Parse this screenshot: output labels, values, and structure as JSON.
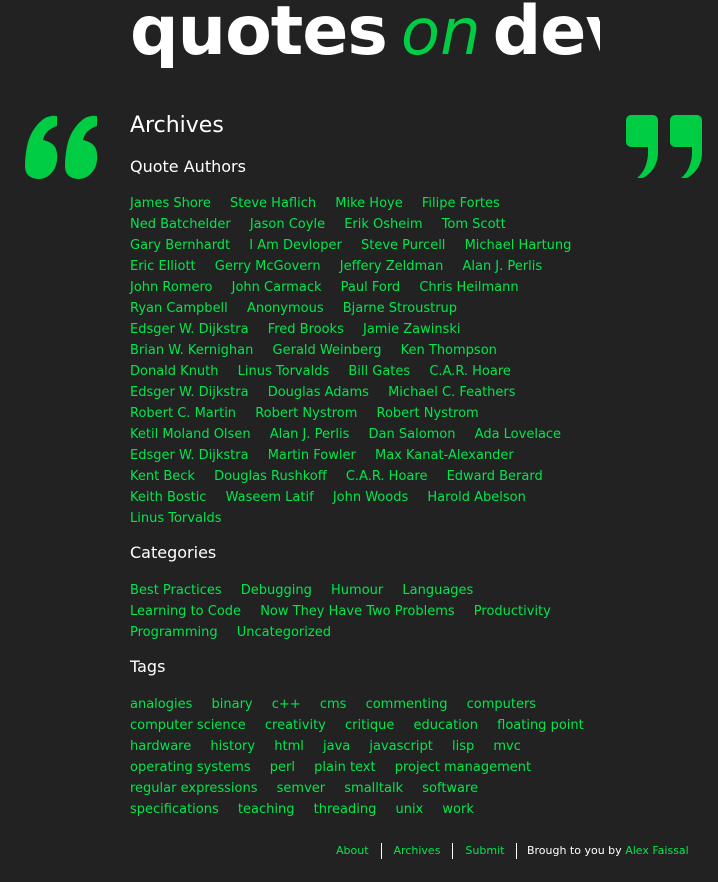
{
  "logo": {
    "word1": "quotes",
    "word2": "on",
    "word3": "dev"
  },
  "archives_title": "Archives",
  "authors": {
    "title": "Quote Authors",
    "items": [
      "James Shore",
      "Steve Haflich",
      "Mike Hoye",
      "Filipe Fortes",
      "Ned Batchelder",
      "Jason Coyle",
      "Erik Osheim",
      "Tom Scott",
      "Gary Bernhardt",
      "I Am Devloper",
      "Steve Purcell",
      "Michael Hartung",
      "Eric Elliott",
      "Gerry McGovern",
      "Jeffery Zeldman",
      "Alan J. Perlis",
      "John Romero",
      "John Carmack",
      "Paul Ford",
      "Chris Heilmann",
      "Ryan Campbell",
      "Anonymous",
      "Bjarne Stroustrup",
      "Edsger W. Dijkstra",
      "Fred Brooks",
      "Jamie Zawinski",
      "Brian W. Kernighan",
      "Gerald Weinberg",
      "Ken Thompson",
      "Donald Knuth",
      "Linus Torvalds",
      "Bill Gates",
      "C.A.R. Hoare",
      "Edsger W. Dijkstra",
      "Douglas Adams",
      "Michael C. Feathers",
      "Robert C. Martin",
      "Robert Nystrom",
      "Robert Nystrom",
      "Ketil Moland Olsen",
      "Alan J. Perlis",
      "Dan Salomon",
      "Ada Lovelace",
      "Edsger W. Dijkstra",
      "Martin Fowler",
      "Max Kanat-Alexander",
      "Kent Beck",
      "Douglas Rushkoff",
      "C.A.R. Hoare",
      "Edward Berard",
      "Keith Bostic",
      "Waseem Latif",
      "John Woods",
      "Harold Abelson",
      "Linus Torvalds"
    ]
  },
  "categories": {
    "title": "Categories",
    "items": [
      "Best Practices",
      "Debugging",
      "Humour",
      "Languages",
      "Learning to Code",
      "Now They Have Two Problems",
      "Productivity",
      "Programming",
      "Uncategorized"
    ]
  },
  "tags": {
    "title": "Tags",
    "items": [
      "analogies",
      "binary",
      "c++",
      "cms",
      "commenting",
      "computers",
      "computer science",
      "creativity",
      "critique",
      "education",
      "floating point",
      "hardware",
      "history",
      "html",
      "java",
      "javascript",
      "lisp",
      "mvc",
      "operating systems",
      "perl",
      "plain text",
      "project management",
      "regular expressions",
      "semver",
      "smalltalk",
      "software",
      "specifications",
      "teaching",
      "threading",
      "unix",
      "work"
    ]
  },
  "footer": {
    "about": "About",
    "archives": "Archives",
    "submit": "Submit",
    "credit_prefix": "Brough to you by",
    "credit_author": "Alex Faissal"
  },
  "colors": {
    "background": "#222222",
    "accent": "#00cc44",
    "link": "#00e64d",
    "text": "#ffffff"
  },
  "icons": {
    "open": "open-quote-icon",
    "close": "close-quote-icon"
  }
}
